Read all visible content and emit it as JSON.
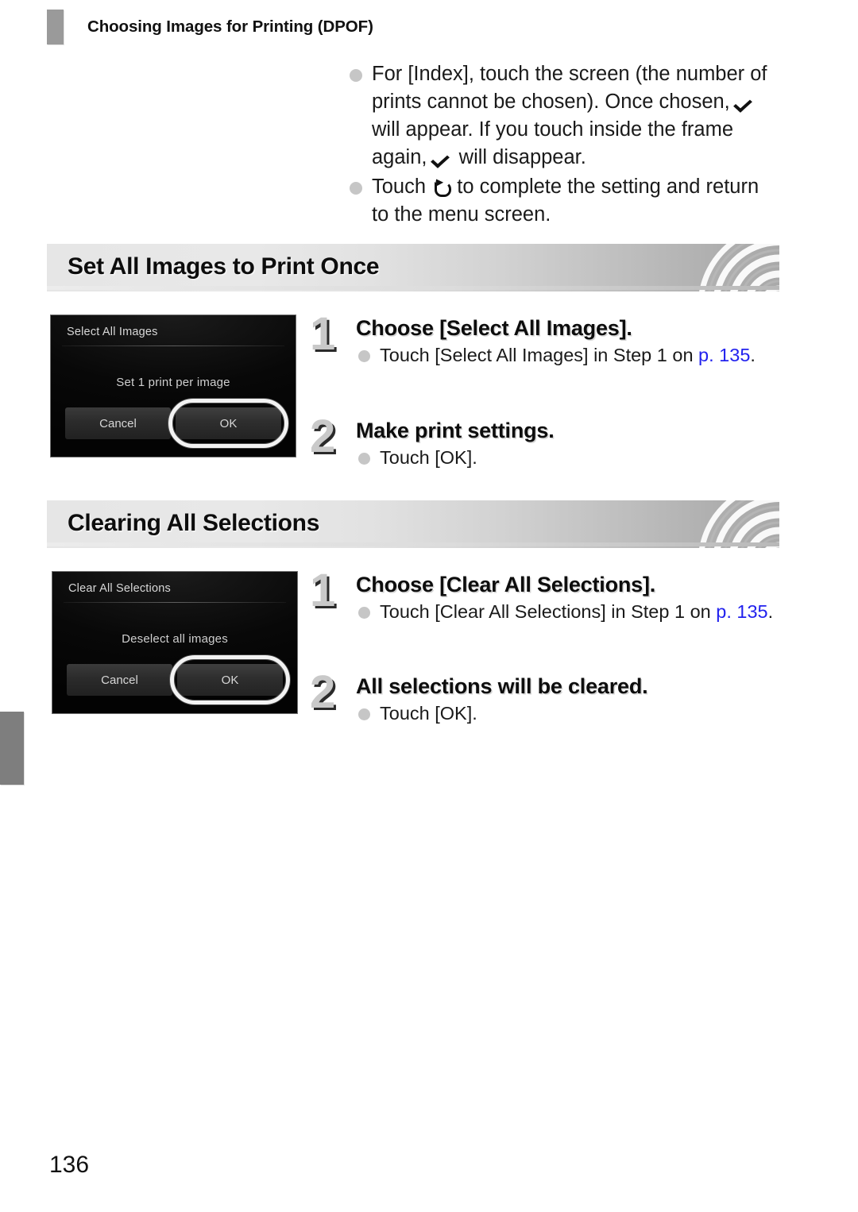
{
  "header": {
    "title": "Choosing Images for Printing (DPOF)",
    "tab_icon": "chapter-tab-marker"
  },
  "intro": {
    "bullets": [
      {
        "pre": "For [Index], touch the screen (the number of prints cannot be chosen). Once chosen,",
        "glyph1": "checkmark-icon",
        "mid": "will appear. If you touch inside the frame again,",
        "glyph2": "checkmark-icon",
        "post": "will disappear."
      },
      {
        "pre": "Touch",
        "glyph1": "return-arrow-icon",
        "mid": "to complete the setting and return to the menu screen.",
        "glyph2": "",
        "post": ""
      }
    ]
  },
  "sections": [
    {
      "band_title": "Set All Images to Print Once",
      "screen": {
        "title": "Select All Images",
        "body": "Set 1 print per image",
        "cancel_label": "Cancel",
        "ok_label": "OK",
        "selected": "OK"
      },
      "steps": [
        {
          "number": "1",
          "heading": "Choose [Select All Images].",
          "bullet_pre": "Touch [Select All Images] in Step 1 on",
          "bullet_link": "p. 135",
          "bullet_post": "."
        },
        {
          "number": "2",
          "heading": "Make print settings.",
          "bullet_pre": "Touch [OK].",
          "bullet_link": "",
          "bullet_post": ""
        }
      ]
    },
    {
      "band_title": "Clearing All Selections",
      "screen": {
        "title": "Clear All Selections",
        "body": "Deselect all images",
        "cancel_label": "Cancel",
        "ok_label": "OK",
        "selected": "OK"
      },
      "steps": [
        {
          "number": "1",
          "heading": "Choose [Clear All Selections].",
          "bullet_pre": "Touch [Clear All Selections] in Step 1 on",
          "bullet_link": "p. 135",
          "bullet_post": "."
        },
        {
          "number": "2",
          "heading": "All selections will be cleared.",
          "bullet_pre": "Touch [OK].",
          "bullet_link": "",
          "bullet_post": ""
        }
      ]
    }
  ],
  "footer": {
    "page_number": "136"
  },
  "colors": {
    "link": "#2222ee",
    "bullet": "#c6c6c6",
    "band_start": "#e6e6e6",
    "band_end": "#a9a9a9",
    "step_number": "#c9c9c9",
    "edge_tab": "#7e7e7e"
  }
}
